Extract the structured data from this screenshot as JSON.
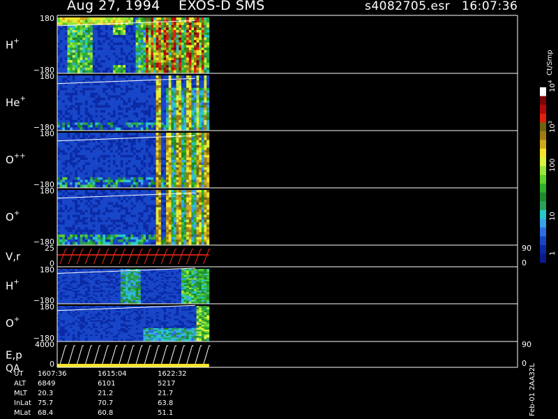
{
  "header": {
    "date": "Aug 27, 1994",
    "instrument": "EXOS-D SMS",
    "file": "s4082705.esr",
    "time": "16:07:36"
  },
  "colorbar": {
    "unit_label": "Ct/Smp",
    "ticks": [
      "1",
      "10",
      "100",
      "10",
      "10"
    ],
    "tick_superscripts": [
      "",
      "",
      "",
      "3",
      "4"
    ],
    "colors": [
      "#0b1a8c",
      "#0a2aa6",
      "#1846c8",
      "#2f6ee0",
      "#3aa3e6",
      "#26c9c9",
      "#2aa05a",
      "#1e8a28",
      "#2fb02b",
      "#5fd02c",
      "#9ae63b",
      "#d8f53f",
      "#f5e52a",
      "#d0a81c",
      "#a07a15",
      "#6e6410",
      "#e02010",
      "#b00a0a",
      "#7a0606",
      "#ffffff"
    ]
  },
  "footer": {
    "version": "Feb-01 2AA32L",
    "rows": [
      {
        "label": "UT",
        "values": [
          "1607:36",
          "1615:04",
          "1622:32"
        ]
      },
      {
        "label": "ALT",
        "values": [
          "6849",
          "6101",
          "5217"
        ]
      },
      {
        "label": "MLT",
        "values": [
          "20.3",
          "21.2",
          "21.7"
        ]
      },
      {
        "label": "InLat",
        "values": [
          "75.7",
          "70.7",
          "63.8"
        ]
      },
      {
        "label": "MLat",
        "values": [
          "68.4",
          "60.8",
          "51.1"
        ]
      }
    ]
  },
  "chart_data": {
    "type": "heatmap",
    "colorbar_scale": "log",
    "colorbar_range": [
      1,
      10000
    ],
    "panels": [
      {
        "label": "H",
        "sup": "+",
        "kind": "spectrogram",
        "ymin_label": "−180",
        "ymax_label": "180",
        "ylim": [
          -180,
          180
        ],
        "pattern": "h1"
      },
      {
        "label": "He",
        "sup": "+",
        "kind": "spectrogram",
        "ymin_label": "−180",
        "ymax_label": "180",
        "ylim": [
          -180,
          180
        ],
        "pattern": "he"
      },
      {
        "label": "O",
        "sup": "++",
        "kind": "spectrogram",
        "ymin_label": "−180",
        "ymax_label": "180",
        "ylim": [
          -180,
          180
        ],
        "pattern": "o2"
      },
      {
        "label": "O",
        "sup": "+",
        "kind": "spectrogram",
        "ymin_label": "−180",
        "ymax_label": "180",
        "ylim": [
          -180,
          180
        ],
        "pattern": "o1"
      },
      {
        "label": "V,r",
        "sup": "",
        "kind": "line",
        "ymin_label": "0",
        "ymax_label": "25",
        "ylim": [
          0,
          25
        ],
        "right_min": "0",
        "right_max": "90"
      },
      {
        "label": "H",
        "sup": "+",
        "kind": "spectrogram",
        "ymin_label": "−180",
        "ymax_label": "180",
        "ylim": [
          -180,
          180
        ],
        "pattern": "h2"
      },
      {
        "label": "O",
        "sup": "+",
        "kind": "spectrogram",
        "ymin_label": "−180",
        "ymax_label": "180",
        "ylim": [
          -180,
          180
        ],
        "pattern": "o3"
      },
      {
        "label": "E,p",
        "sub_label": "QA",
        "sup": "",
        "kind": "line",
        "ymin_label": "0",
        "ymax_label": "4000",
        "ylim": [
          0,
          4000
        ],
        "right_min": "0",
        "right_max": "90"
      }
    ],
    "data_fraction_of_interval": 0.33
  }
}
